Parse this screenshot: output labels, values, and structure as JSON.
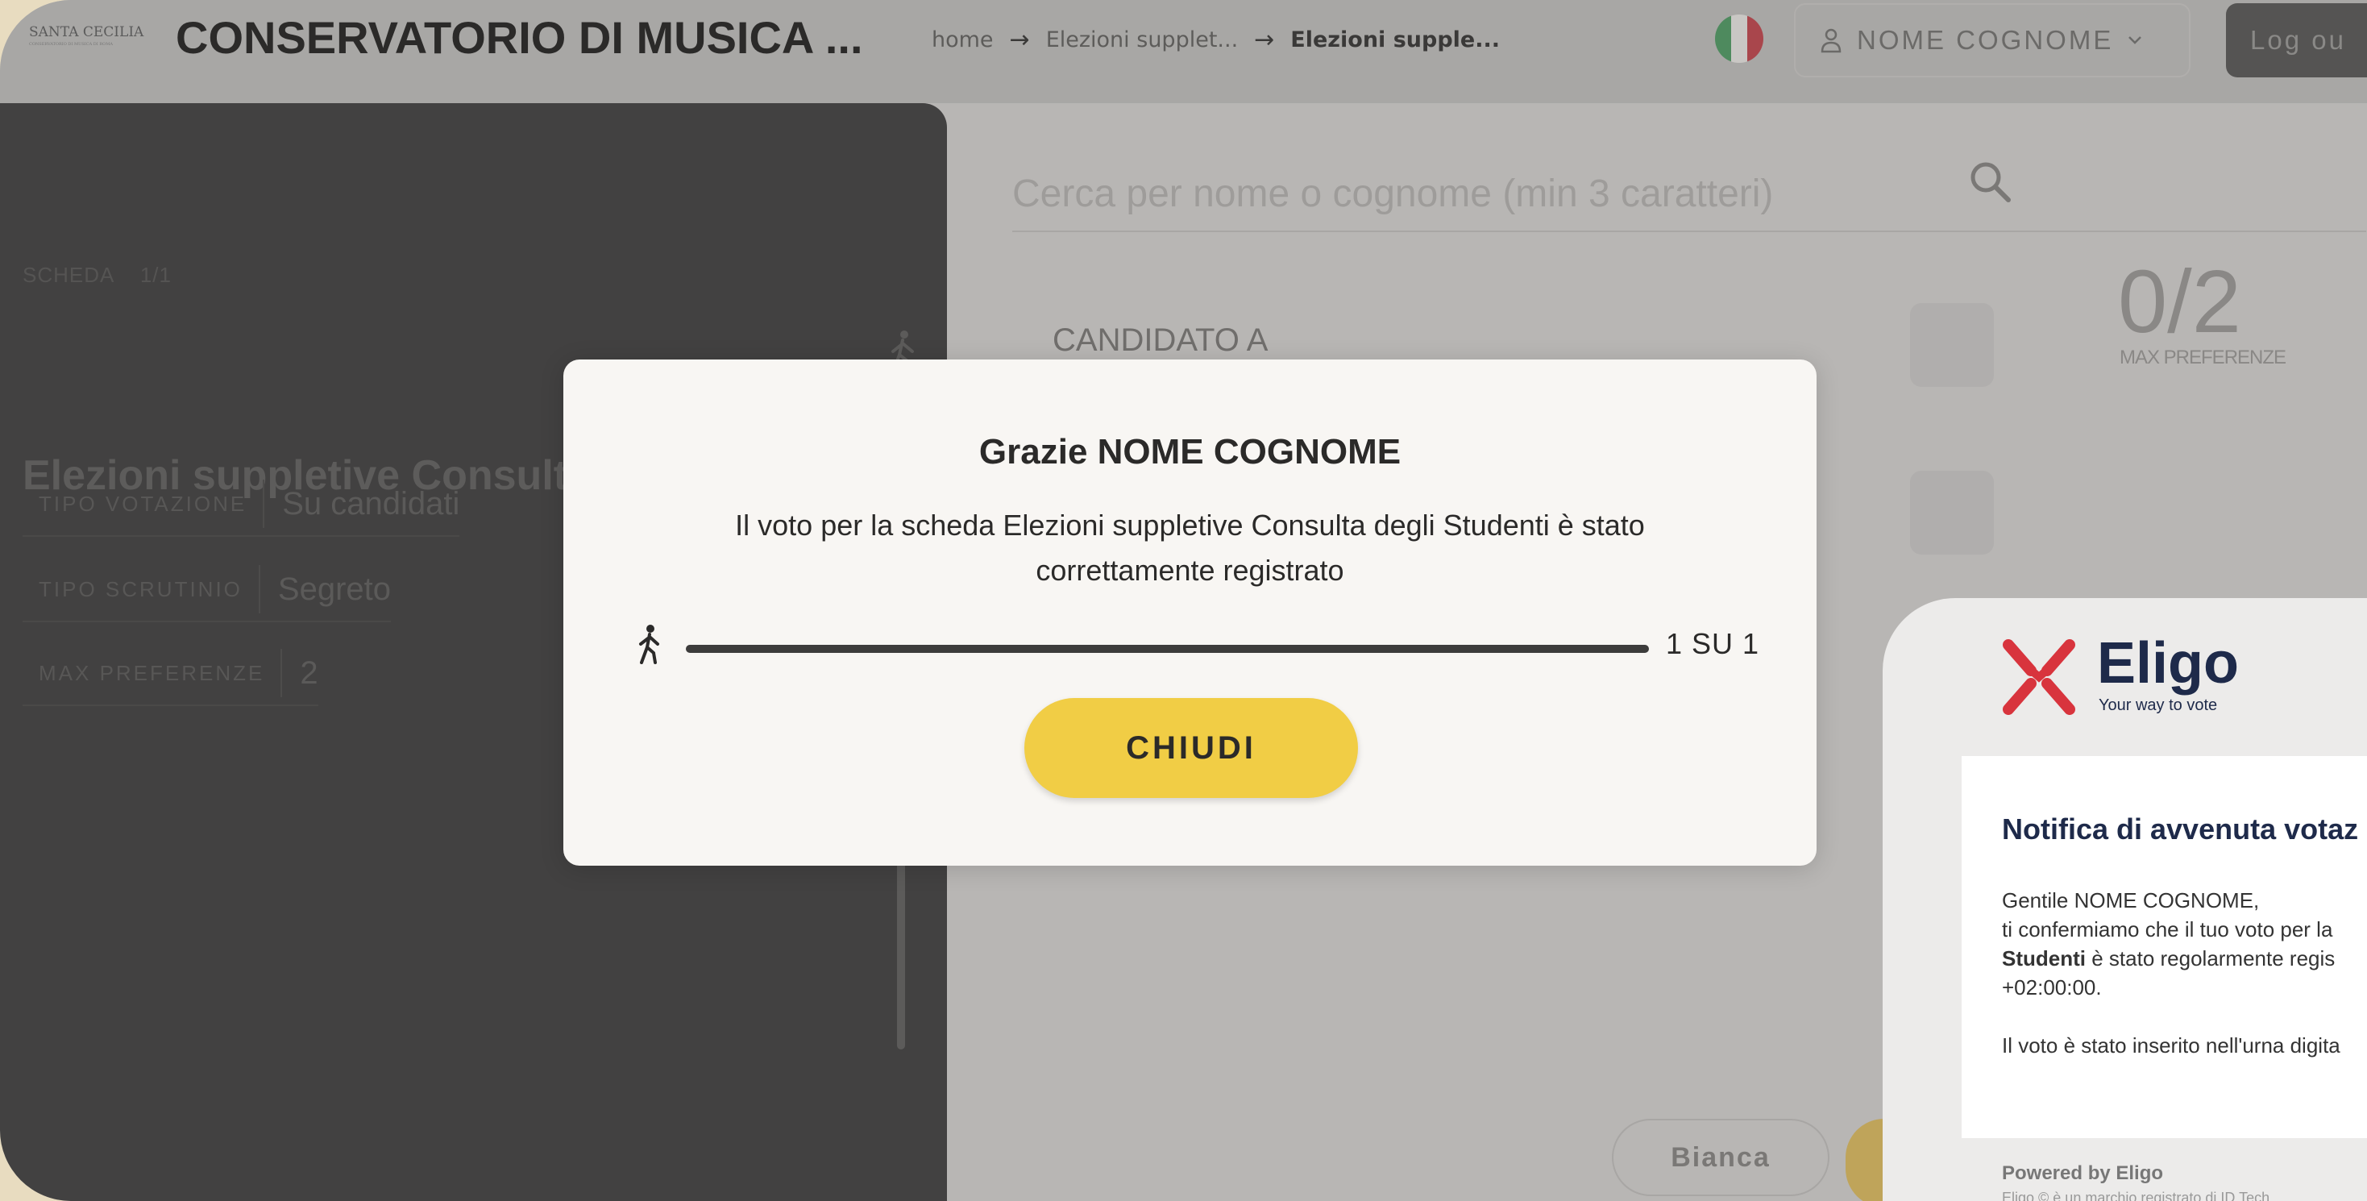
{
  "header": {
    "logo_text": "SANTA CECILIA",
    "logo_subtext": "CONSERVATORIO DI MUSICA DI ROMA",
    "app_title": "CONSERVATORIO DI MUSICA ...",
    "breadcrumb": [
      {
        "label": "home"
      },
      {
        "label": "Elezioni supplet..."
      },
      {
        "label": "Elezioni supple..."
      }
    ],
    "flag_colors": [
      "#009246",
      "#ffffff",
      "#ce2b37"
    ],
    "user_name": "NOME COGNOME",
    "logout_label": "Log ou"
  },
  "left_panel": {
    "scheda_label": "SCHEDA",
    "scheda_counter": "1/1",
    "title": "Elezioni suppletive Consulta degli Studenti",
    "meta": [
      {
        "key": "TIPO VOTAZIONE",
        "value": "Su candidati"
      },
      {
        "key": "TIPO SCRUTINIO",
        "value": "Segreto"
      },
      {
        "key": "MAX PREFERENZE",
        "value": "2"
      }
    ]
  },
  "main": {
    "search_placeholder": "Cerca per nome o cognome (min 3 caratteri)",
    "candidates": [
      {
        "name": "CANDIDATO A"
      }
    ],
    "pref_count": "0/2",
    "pref_label": "MAX PREFERENZE",
    "bianca_label": "Bianca"
  },
  "modal": {
    "title": "Grazie NOME COGNOME",
    "message": "Il voto per la scheda Elezioni suppletive Consulta degli Studenti è stato correttamente registrato",
    "progress_fraction": 1.0,
    "progress_text": "1 SU 1",
    "close_label": "CHIUDI"
  },
  "email": {
    "brand": "Eligo",
    "tagline": "Your way to vote",
    "heading": "Notifica di avvenuta votaz",
    "greeting": "Gentile NOME COGNOME,",
    "line1": "ti confermiamo che il tuo voto per la",
    "line2_bold": "Studenti",
    "line2_rest": " è stato regolarmente regis",
    "line3": "+02:00:00.",
    "line4": "Il voto è stato inserito nell'urna digita",
    "powered_by": "Powered by Eligo",
    "footer": "Eligo © è un marchio registrato di ID Tech"
  },
  "colors": {
    "accent_yellow": "#f1cd45",
    "eligo_red": "#d8343d",
    "eligo_navy": "#1e2a4a"
  }
}
